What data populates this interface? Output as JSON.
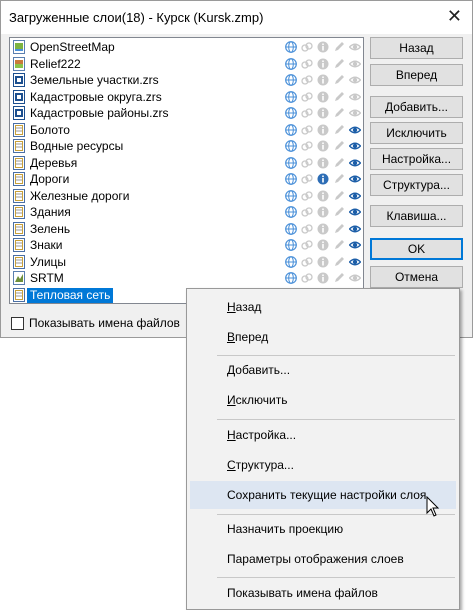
{
  "window": {
    "title": "Загруженные слои(18) - Курск (Kursk.zmp)",
    "close_glyph": "✕"
  },
  "layers": [
    {
      "name": "OpenStreetMap",
      "icon": "map-layer-icon",
      "info": false,
      "eye": false
    },
    {
      "name": "Relief222",
      "icon": "relief-layer-icon",
      "info": false,
      "eye": false
    },
    {
      "name": "Земельные участки.zrs",
      "icon": "zrs-layer-icon",
      "info": false,
      "eye": false
    },
    {
      "name": "Кадастровые округа.zrs",
      "icon": "zrs-layer-icon",
      "info": false,
      "eye": false
    },
    {
      "name": "Кадастровые районы.zrs",
      "icon": "zrs-layer-icon",
      "info": false,
      "eye": false
    },
    {
      "name": "Болото",
      "icon": "vector-layer-icon",
      "info": false,
      "eye": true
    },
    {
      "name": "Водные ресурсы",
      "icon": "vector-layer-icon",
      "info": false,
      "eye": true
    },
    {
      "name": "Деревья",
      "icon": "vector-layer-icon",
      "info": false,
      "eye": true
    },
    {
      "name": "Дороги",
      "icon": "vector-layer-icon",
      "info": true,
      "eye": true
    },
    {
      "name": "Железные дороги",
      "icon": "vector-layer-icon",
      "info": false,
      "eye": true
    },
    {
      "name": "Здания",
      "icon": "vector-layer-icon",
      "info": false,
      "eye": true
    },
    {
      "name": "Зелень",
      "icon": "vector-layer-icon",
      "info": false,
      "eye": true
    },
    {
      "name": "Знаки",
      "icon": "vector-layer-icon",
      "info": false,
      "eye": true
    },
    {
      "name": "Улицы",
      "icon": "vector-layer-icon",
      "info": false,
      "eye": true
    },
    {
      "name": "SRTM",
      "icon": "srtm-layer-icon",
      "info": false,
      "eye": false
    },
    {
      "name": "Тепловая сеть",
      "icon": "vector-layer-icon",
      "info": false,
      "eye": true,
      "selected": true
    }
  ],
  "buttons": {
    "up": "Назад",
    "down": "Вперед",
    "add": "Добавить...",
    "remove": "Исключить",
    "settings": "Настройка...",
    "structure": "Структура...",
    "keys": "Клавиша...",
    "ok": "OK",
    "cancel": "Отмена"
  },
  "show_file_names": {
    "label": "Показывать имена файлов",
    "checked": false
  },
  "context_menu": {
    "back": "Назад",
    "forward": "Вперед",
    "add": "Добавить...",
    "exclude": "Исключить",
    "settings": "Настройка...",
    "structure": "Структура...",
    "save_settings": "Сохранить текущие настройки слоя",
    "assign_projection": "Назначить проекцию",
    "display_params": "Параметры отображения слоев",
    "show_file_names": "Показывать имена файлов"
  },
  "colors": {
    "selection": "#0078d7",
    "menu_highlight": "#dde6f2",
    "globe": "#4a90d9",
    "info": "#2d6db5",
    "eye": "#1c5ea8",
    "disabled": "#c9c9c9"
  }
}
